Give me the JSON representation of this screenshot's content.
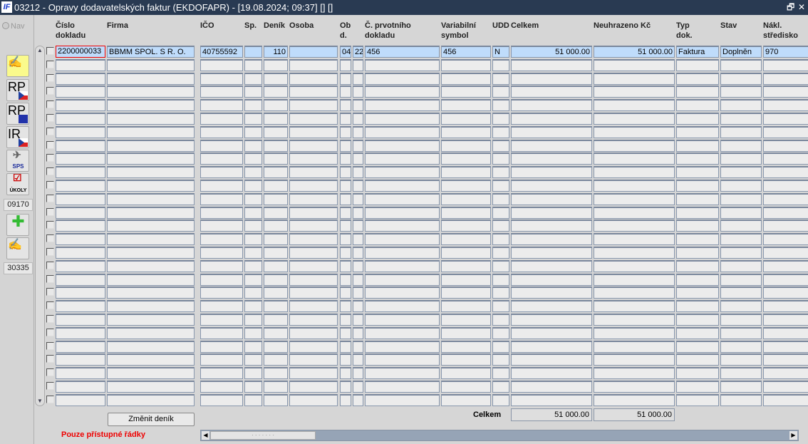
{
  "window": {
    "title": "03212 - Opravy dodavatelských faktur (EKDOFAPR) - [19.08.2024; 09:37] [] []",
    "logo": "IF",
    "restore_icon": "restore-icon",
    "close_icon": "close-icon"
  },
  "sidebar": {
    "nav_label": "Nav",
    "buttons": [
      {
        "name": "edit-document",
        "label": ""
      },
      {
        "name": "rp-cz",
        "label": "RP"
      },
      {
        "name": "rp-eu",
        "label": "RP"
      },
      {
        "name": "ir-cz",
        "label": "IR"
      },
      {
        "name": "sps",
        "label": "SPS"
      },
      {
        "name": "ukoly",
        "label": "ÚKOLY"
      }
    ],
    "counter1": "09170",
    "counter2": "30335"
  },
  "table": {
    "columns": [
      {
        "key": "cislo",
        "label": "Číslo\ndokladu"
      },
      {
        "key": "firma",
        "label": "Firma"
      },
      {
        "key": "ico",
        "label": "IČO"
      },
      {
        "key": "sp",
        "label": "Sp."
      },
      {
        "key": "denik",
        "label": "Deník"
      },
      {
        "key": "osoba",
        "label": "Osoba"
      },
      {
        "key": "ob",
        "label": "Ob\nd."
      },
      {
        "key": "ob2",
        "label": ""
      },
      {
        "key": "prvotni",
        "label": "Č. prvotního\ndokladu"
      },
      {
        "key": "vs",
        "label": "Variabilní\nsymbol"
      },
      {
        "key": "udd",
        "label": "UDD"
      },
      {
        "key": "celkem",
        "label": "Celkem"
      },
      {
        "key": "neuhrazeno",
        "label": "Neuhrazeno Kč"
      },
      {
        "key": "typ",
        "label": "Typ\ndok."
      },
      {
        "key": "stav",
        "label": "Stav"
      },
      {
        "key": "nakl",
        "label": "Nákl.\nstředisko"
      }
    ],
    "rows": [
      {
        "cislo": "2200000033",
        "firma": "BBMM SPOL. S R. O.",
        "ico": "40755592",
        "sp": "",
        "denik": "110",
        "osoba": "",
        "ob": "04",
        "ob2": "22",
        "prvotni": "456",
        "vs": "456",
        "udd": "N",
        "celkem": "51 000.00",
        "neuhrazeno": "51 000.00",
        "typ": "Faktura",
        "stav": "Doplněn",
        "nakl": "970"
      }
    ]
  },
  "footer": {
    "total_label": "Celkem",
    "total_celkem": "51 000.00",
    "total_neuhrazeno": "51 000.00",
    "change_button": "Změnit deník",
    "status": "Pouze přístupné řádky"
  }
}
